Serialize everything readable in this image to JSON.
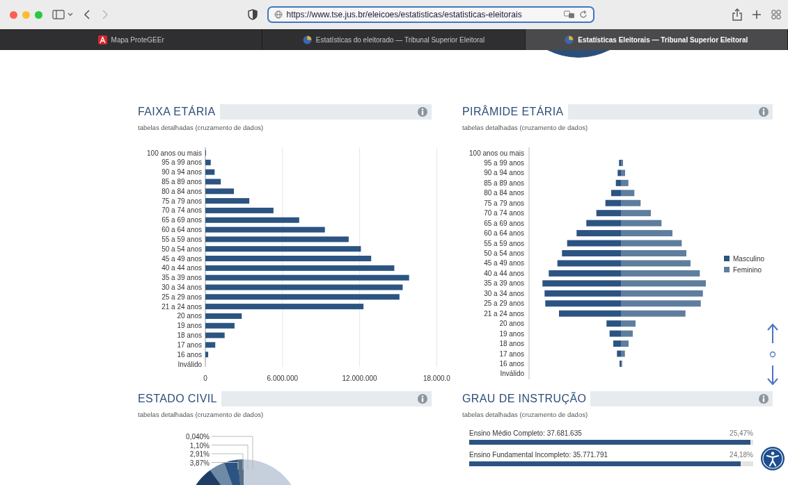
{
  "browser": {
    "url": "https://www.tse.jus.br/eleicoes/estatisticas/estatisticas-eleitorais",
    "tabs": [
      {
        "title": "Mapa ProteGEEr",
        "kind": "pdf",
        "selected": false
      },
      {
        "title": "Estatísticas do eleitorado — Tribunal Superior Eleitoral",
        "kind": "site",
        "selected": false
      },
      {
        "title": "Estatísticas Eleitorais — Tribunal Superior Eleitoral",
        "kind": "site",
        "selected": true
      }
    ]
  },
  "sections": [
    {
      "kind": "bar_chart",
      "title": "FAIXA ETÁRIA",
      "subtitle": "tabelas detalhadas (cruzamento de dados)",
      "chart_data": {
        "type": "bar",
        "orientation": "horizontal",
        "categories": [
          "100 anos ou mais",
          "95 a 99 anos",
          "90 a 94 anos",
          "85 a 89 anos",
          "80 a 84 anos",
          "75 a 79 anos",
          "70 a 74 anos",
          "65 a 69 anos",
          "60 a 64 anos",
          "55 a 59 anos",
          "50 a 54 anos",
          "45 a 49 anos",
          "40 a 44 anos",
          "35 a 39 anos",
          "30 a 34 anos",
          "25 a 29 anos",
          "21 a 24 anos",
          "20 anos",
          "19 anos",
          "18 anos",
          "17 anos",
          "16 anos",
          "Inválido"
        ],
        "values": [
          20000,
          420000,
          720000,
          1200000,
          2220000,
          3420000,
          5300000,
          7300000,
          9300000,
          11150000,
          12100000,
          12900000,
          14700000,
          15850000,
          15350000,
          15100000,
          12300000,
          2830000,
          2270000,
          1500000,
          770000,
          220000,
          0
        ],
        "xlim": [
          0,
          18000000
        ],
        "xticks": [
          {
            "value": 0,
            "label": "0"
          },
          {
            "value": 6000000,
            "label": "6.000.000"
          },
          {
            "value": 12000000,
            "label": "12.000.000"
          },
          {
            "value": 18000000,
            "label": "18.000.0"
          }
        ]
      }
    },
    {
      "kind": "pyramid",
      "title": "PIRÂMIDE ETÁRIA",
      "subtitle": "tabelas detalhadas (cruzamento de dados)",
      "categories": [
        "100 anos ou mais",
        "95 a 99 anos",
        "90 a 94 anos",
        "85 a 89 anos",
        "80 a 84 anos",
        "75 a 79 anos",
        "70 a 74 anos",
        "65 a 69 anos",
        "60 a 64 anos",
        "55 a 59 anos",
        "50 a 54 anos",
        "45 a 49 anos",
        "40 a 44 anos",
        "35 a 39 anos",
        "30 a 34 anos",
        "25 a 29 anos",
        "21 a 24 anos",
        "20 anos",
        "19 anos",
        "18 anos",
        "17 anos",
        "16 anos",
        "Inválido"
      ],
      "legend": [
        {
          "label": "Masculino",
          "color": "#2c5482"
        },
        {
          "label": "Feminino",
          "color": "#5f7e9e"
        }
      ]
    },
    {
      "kind": "pie",
      "title": "ESTADO CIVIL",
      "subtitle": "tabelas detalhadas (cruzamento de dados)",
      "labels": [
        "0,040%",
        "1,10%",
        "2,91%",
        "3,87%"
      ]
    },
    {
      "kind": "progress_list",
      "title": "GRAU DE INSTRUÇÃO",
      "subtitle": "tabelas detalhadas (cruzamento de dados)",
      "rows": [
        {
          "label": "Ensino Médio Completo: 37.681.635",
          "percent": "25,47%",
          "level": 0.99
        },
        {
          "label": "Ensino Fundamental Incompleto: 35.771.791",
          "percent": "24,18%",
          "level": 0.955
        }
      ]
    }
  ]
}
